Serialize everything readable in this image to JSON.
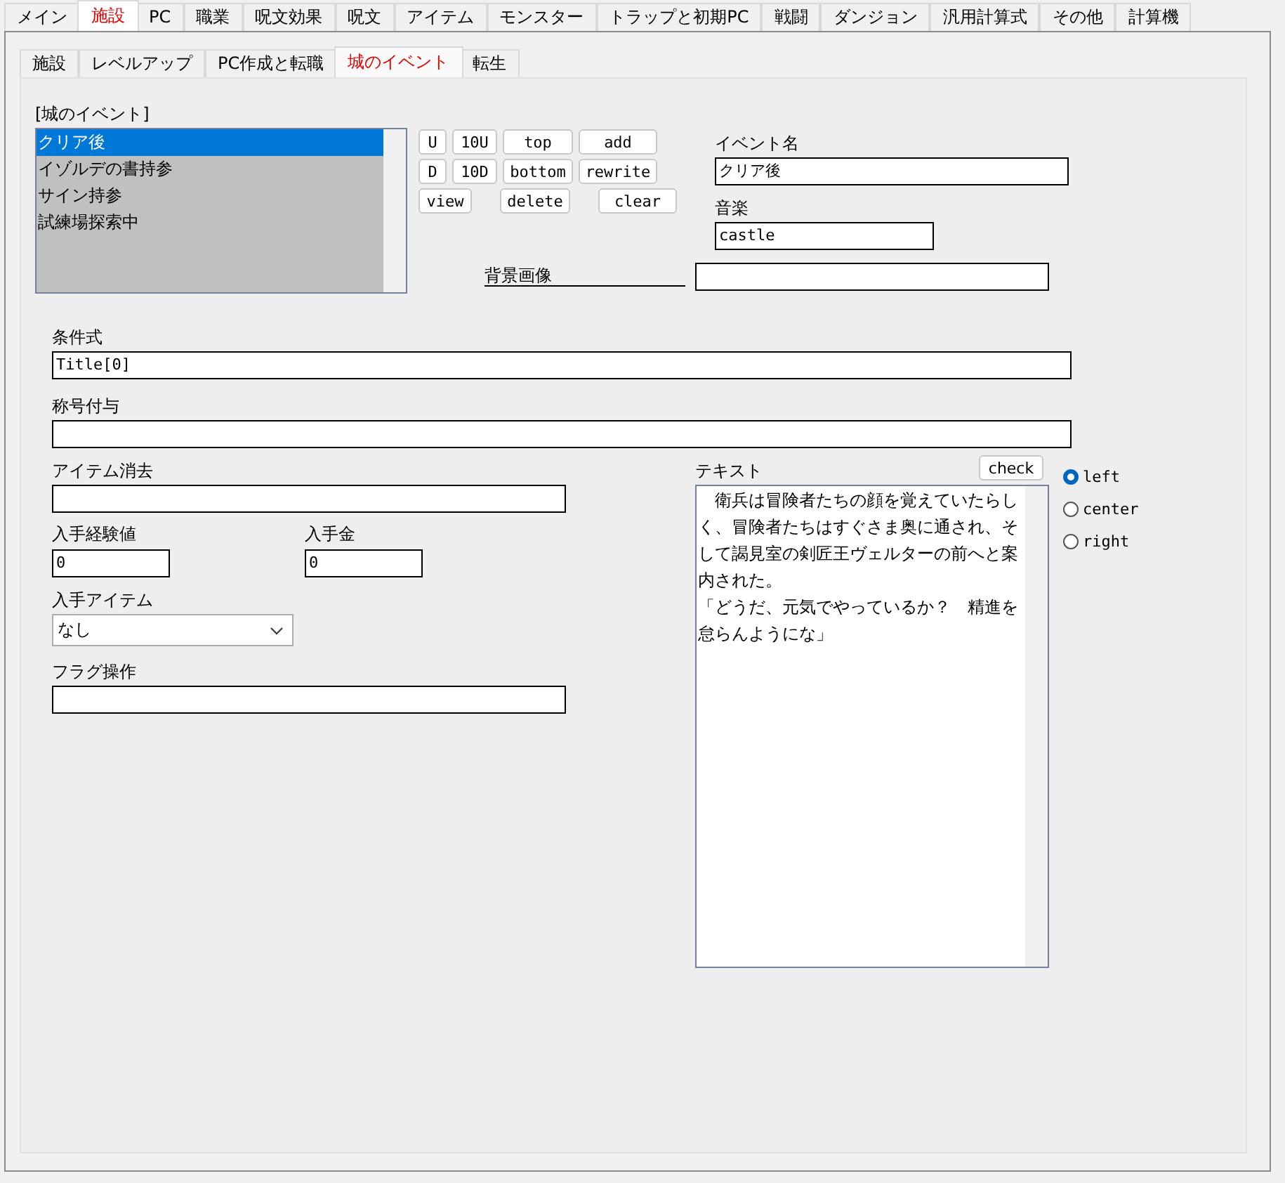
{
  "main_tabs": [
    {
      "label": "メイン",
      "selected": false
    },
    {
      "label": "施設",
      "selected": true
    },
    {
      "label": "PC",
      "selected": false
    },
    {
      "label": "職業",
      "selected": false
    },
    {
      "label": "呪文効果",
      "selected": false
    },
    {
      "label": "呪文",
      "selected": false
    },
    {
      "label": "アイテム",
      "selected": false
    },
    {
      "label": "モンスター",
      "selected": false
    },
    {
      "label": "トラップと初期PC",
      "selected": false
    },
    {
      "label": "戦闘",
      "selected": false
    },
    {
      "label": "ダンジョン",
      "selected": false
    },
    {
      "label": "汎用計算式",
      "selected": false
    },
    {
      "label": "その他",
      "selected": false
    },
    {
      "label": "計算機",
      "selected": false
    }
  ],
  "sub_tabs": [
    {
      "label": "施設",
      "selected": false
    },
    {
      "label": "レベルアップ",
      "selected": false
    },
    {
      "label": "PC作成と転職",
      "selected": false
    },
    {
      "label": "城のイベント",
      "selected": true
    },
    {
      "label": "転生",
      "selected": false
    }
  ],
  "event_list": {
    "label": "[城のイベント]",
    "items": [
      {
        "label": "クリア後",
        "selected": true
      },
      {
        "label": "イゾルデの書持参",
        "selected": false
      },
      {
        "label": "サイン持参",
        "selected": false
      },
      {
        "label": "試練場探索中",
        "selected": false
      }
    ]
  },
  "list_buttons": [
    [
      "U",
      "10U",
      "top",
      "add"
    ],
    [
      "D",
      "10D",
      "bottom",
      "rewrite"
    ],
    [
      "view",
      "delete",
      "clear"
    ]
  ],
  "event_name": {
    "label": "イベント名",
    "value": "クリア後"
  },
  "music": {
    "label": "音楽",
    "value": "castle"
  },
  "background_image": {
    "label": "背景画像"
  },
  "condition": {
    "label": "条件式",
    "value": "Title[0]"
  },
  "title_grant": {
    "label": "称号付与"
  },
  "item_remove": {
    "label": "アイテム消去"
  },
  "exp": {
    "label": "入手経験値",
    "value": "0"
  },
  "gold": {
    "label": "入手金",
    "value": "0"
  },
  "item_get": {
    "label": "入手アイテム",
    "value": "なし"
  },
  "flag": {
    "label": "フラグ操作"
  },
  "text": {
    "label": "テキスト",
    "check": "check",
    "paragraphs": [
      "　衛兵は冒険者たちの顔を覚えていたらしく、冒険者たちはすぐさま奥に通され、そして謁見室の剣匠王ヴェルターの前へと案内された。",
      "「どうだ、元気でやっているか？　精進を怠らんようにな」"
    ]
  },
  "alignment": [
    {
      "label": "left",
      "selected": true
    },
    {
      "label": "center",
      "selected": false
    },
    {
      "label": "right",
      "selected": false
    }
  ]
}
